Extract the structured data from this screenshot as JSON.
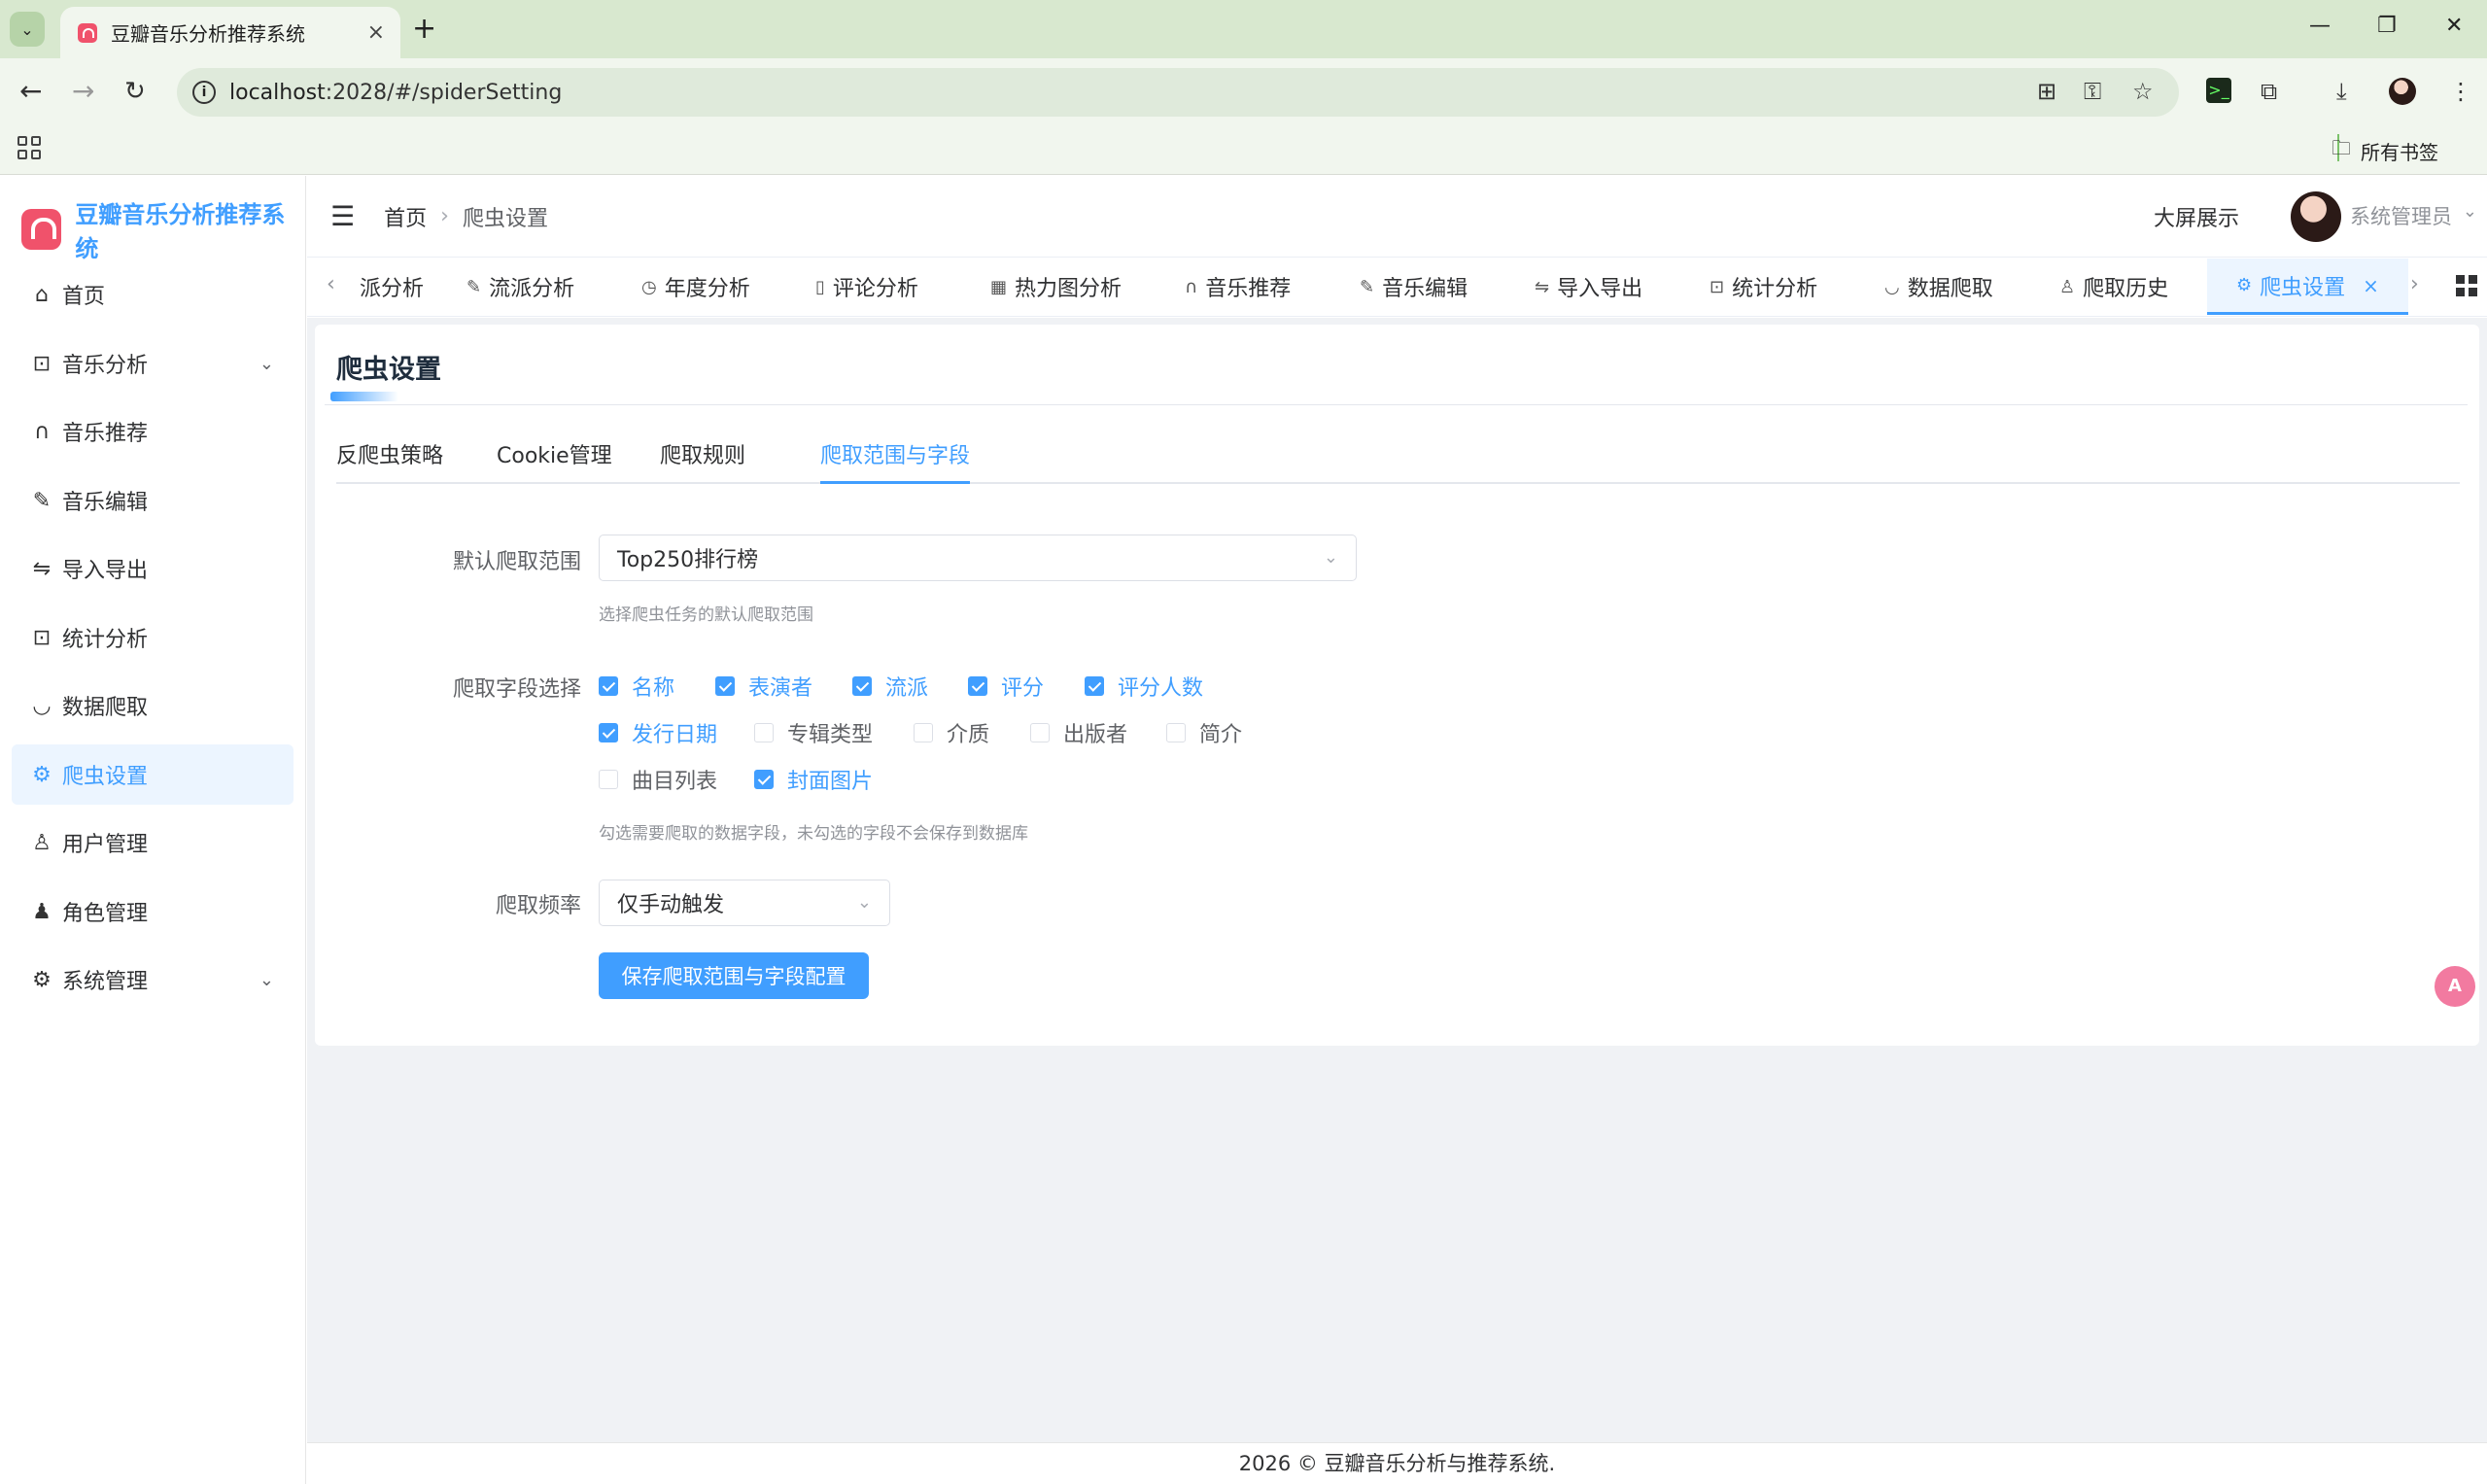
{
  "browser": {
    "tab_title": "豆瓣音乐分析推荐系统",
    "tab_close": "×",
    "new_tab": "+",
    "url_host": "localhost",
    "url_path": ":2028/#/spiderSetting",
    "bookmarks_all": "所有书签",
    "window_controls": [
      "—",
      "❐",
      "✕"
    ]
  },
  "app": {
    "brand": "豆瓣音乐分析推荐系统",
    "header": {
      "breadcrumb_home": "首页",
      "breadcrumb_current": "爬虫设置",
      "big_screen": "大屏展示",
      "username": "系统管理员"
    },
    "sidebar": [
      {
        "label": "首页",
        "icon": "home-icon"
      },
      {
        "label": "音乐分析",
        "icon": "presentation-icon",
        "expandable": true
      },
      {
        "label": "音乐推荐",
        "icon": "headphones-icon"
      },
      {
        "label": "音乐编辑",
        "icon": "edit-pen-icon"
      },
      {
        "label": "导入导出",
        "icon": "switch-icon"
      },
      {
        "label": "统计分析",
        "icon": "presentation-icon"
      },
      {
        "label": "数据爬取",
        "icon": "bowl-icon"
      },
      {
        "label": "爬虫设置",
        "icon": "gear-icon",
        "active": true
      },
      {
        "label": "用户管理",
        "icon": "user-icon"
      },
      {
        "label": "角色管理",
        "icon": "user-filled-icon"
      },
      {
        "label": "系统管理",
        "icon": "gear-icon",
        "expandable": true
      }
    ],
    "tags": [
      {
        "label": "派分析",
        "icon": "none"
      },
      {
        "label": "流派分析",
        "icon": "paperclip-icon"
      },
      {
        "label": "年度分析",
        "icon": "clock-icon"
      },
      {
        "label": "评论分析",
        "icon": "book-icon"
      },
      {
        "label": "热力图分析",
        "icon": "grid-icon"
      },
      {
        "label": "音乐推荐",
        "icon": "headphones-icon"
      },
      {
        "label": "音乐编辑",
        "icon": "edit-pen-icon"
      },
      {
        "label": "导入导出",
        "icon": "switch-icon"
      },
      {
        "label": "统计分析",
        "icon": "presentation-icon"
      },
      {
        "label": "数据爬取",
        "icon": "bowl-icon"
      },
      {
        "label": "爬取历史",
        "icon": "user-icon"
      },
      {
        "label": "爬虫设置",
        "icon": "gear-icon",
        "active": true
      }
    ],
    "card": {
      "title": "爬虫设置",
      "tabs": [
        "反爬虫策略",
        "Cookie管理",
        "爬取规则",
        "爬取范围与字段"
      ],
      "active_tab": 3,
      "form": {
        "scope_label": "默认爬取范围",
        "scope_value": "Top250排行榜",
        "scope_hint": "选择爬虫任务的默认爬取范围",
        "fields_label": "爬取字段选择",
        "fields": [
          {
            "label": "名称",
            "checked": true
          },
          {
            "label": "表演者",
            "checked": true
          },
          {
            "label": "流派",
            "checked": true
          },
          {
            "label": "评分",
            "checked": true
          },
          {
            "label": "评分人数",
            "checked": true
          },
          {
            "label": "发行日期",
            "checked": true
          },
          {
            "label": "专辑类型",
            "checked": false
          },
          {
            "label": "介质",
            "checked": false
          },
          {
            "label": "出版者",
            "checked": false
          },
          {
            "label": "简介",
            "checked": false
          },
          {
            "label": "曲目列表",
            "checked": false
          },
          {
            "label": "封面图片",
            "checked": true
          }
        ],
        "fields_hint": "勾选需要爬取的数据字段，未勾选的字段不会保存到数据库",
        "freq_label": "爬取频率",
        "freq_value": "仅手动触发",
        "save_button": "保存爬取范围与字段配置"
      }
    },
    "footer": "2026 © 豆瓣音乐分析与推荐系统.",
    "accent_color": "#409eff",
    "brand_color": "#f0526b"
  }
}
